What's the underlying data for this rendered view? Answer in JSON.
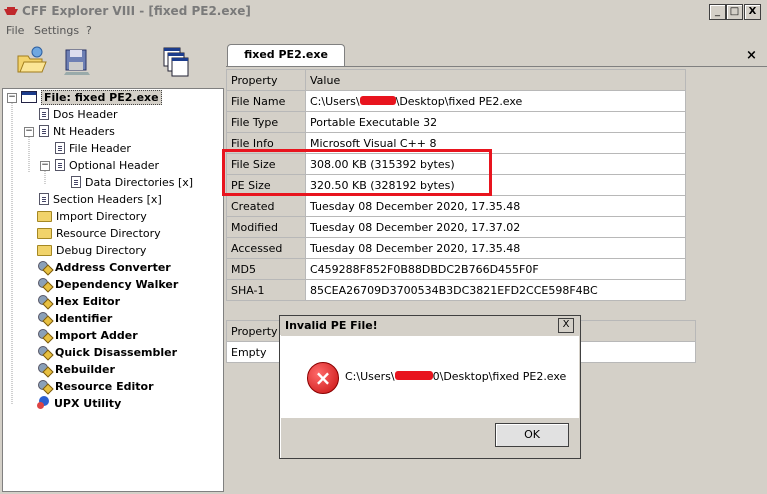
{
  "window": {
    "title": "CFF Explorer VIII - [fixed PE2.exe]",
    "minimize": "_",
    "maximize": "□",
    "close": "X"
  },
  "menu": [
    "File",
    "Settings",
    "?"
  ],
  "toolbar": [
    "open-icon",
    "save-icon",
    "windows-icon"
  ],
  "tree": {
    "root": "File: fixed PE2.exe",
    "items": [
      {
        "label": "Dos Header"
      },
      {
        "label": "Nt Headers"
      },
      {
        "label": "File Header"
      },
      {
        "label": "Optional Header"
      },
      {
        "label": "Data Directories [x]"
      },
      {
        "label": "Section Headers [x]"
      },
      {
        "label": "Import Directory"
      },
      {
        "label": "Resource Directory"
      },
      {
        "label": "Debug Directory"
      },
      {
        "label": "Address Converter"
      },
      {
        "label": "Dependency Walker"
      },
      {
        "label": "Hex Editor"
      },
      {
        "label": "Identifier"
      },
      {
        "label": "Import Adder"
      },
      {
        "label": "Quick Disassembler"
      },
      {
        "label": "Rebuilder"
      },
      {
        "label": "Resource Editor"
      },
      {
        "label": "UPX Utility"
      }
    ]
  },
  "tab": {
    "label": "fixed PE2.exe",
    "close": "×"
  },
  "table": {
    "headers": [
      "Property",
      "Value"
    ],
    "rows": [
      {
        "k": "File Name",
        "v_pre": "C:\\Users\\",
        "v_post": "\\Desktop\\fixed PE2.exe"
      },
      {
        "k": "File Type",
        "v": "Portable Executable 32"
      },
      {
        "k": "File Info",
        "v": "Microsoft Visual C++ 8"
      },
      {
        "k": "File Size",
        "v": "308.00 KB (315392 bytes)"
      },
      {
        "k": "PE Size",
        "v": "320.50 KB (328192 bytes)"
      },
      {
        "k": "Created",
        "v": "Tuesday 08 December 2020, 17.35.48"
      },
      {
        "k": "Modified",
        "v": "Tuesday 08 December 2020, 17.37.02"
      },
      {
        "k": "Accessed",
        "v": "Tuesday 08 December 2020, 17.35.48"
      },
      {
        "k": "MD5",
        "v": "C459288F852F0B88DBDC2B766D455F0F"
      },
      {
        "k": "SHA-1",
        "v": "85CEA26709D3700534B3DC3821EFD2CCE598F4BC"
      }
    ]
  },
  "lower": {
    "header": "Property",
    "row": "Empty"
  },
  "dialog": {
    "title": "Invalid PE File!",
    "close": "X",
    "msg_pre": "C:\\Users\\",
    "msg_post": "0\\Desktop\\fixed PE2.exe",
    "ok": "OK",
    "icon": "error-icon"
  },
  "colors": {
    "highlight": "#e8141e"
  }
}
